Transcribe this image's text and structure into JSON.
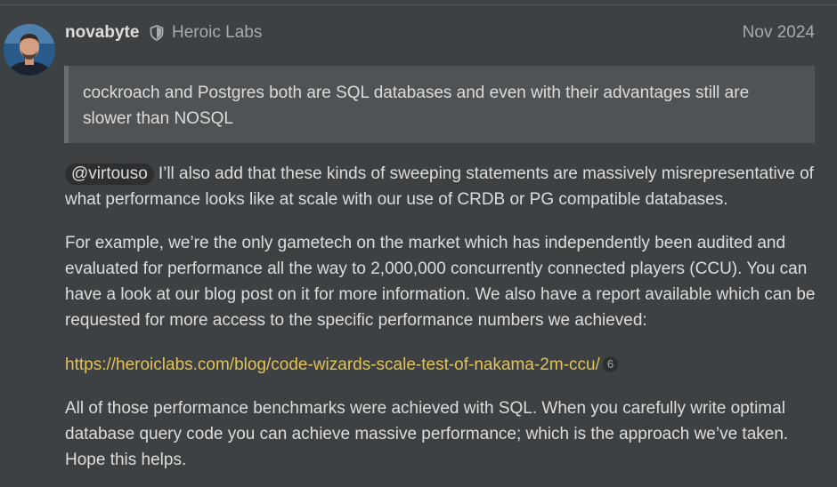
{
  "post": {
    "username": "novabyte",
    "group": "Heroic Labs",
    "date": "Nov 2024",
    "quote": "cockroach and Postgres both are SQL databases and even with their advantages still are slower than NOSQL",
    "mention": "@virtouso",
    "paragraph1_text": "I’ll also add that these kinds of sweeping statements are massively misrepresentative of what performance looks like at scale with our use of CRDB or PG compatible databases.",
    "paragraph2": "For example, we’re the only gametech on the market which has independently been audited and evaluated for performance all the way to 2,000,000 concurrently connected players (CCU). You can have a look at our blog post on it for more information. We also have a report available which can be requested for more access to the specific performance numbers we achieved:",
    "link": {
      "url_text": "https://heroiclabs.com/blog/code-wizards-scale-test-of-nakama-2m-ccu/",
      "click_count": "6"
    },
    "paragraph3": "All of those performance benchmarks were achieved with SQL. When you carefully write optimal database query code you can achieve massive performance; which is the approach we’ve taken. Hope this helps."
  },
  "icons": {
    "group_badge": "shield-icon",
    "avatar": "user-avatar"
  },
  "colors": {
    "background": "#3e4143",
    "quote_background": "#505355",
    "link": "#e2c35a",
    "text": "#dddddd",
    "muted": "#a8abae"
  }
}
